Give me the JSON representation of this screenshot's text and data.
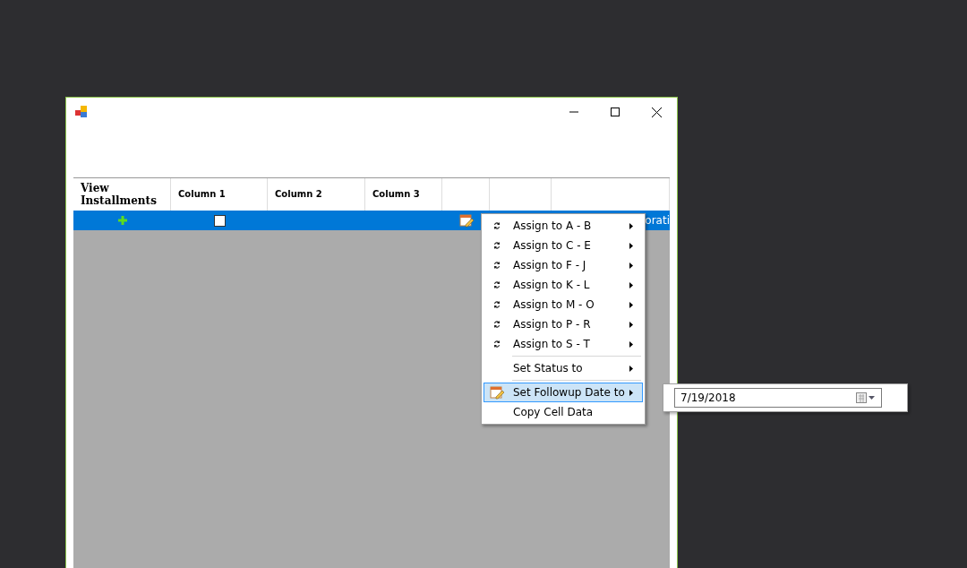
{
  "grid": {
    "columns": [
      {
        "label": "View Installments",
        "kind": "bold"
      },
      {
        "label": "Column 1",
        "kind": "plain"
      },
      {
        "label": "Column 2",
        "kind": "plain"
      },
      {
        "label": "Column 3",
        "kind": "plain"
      },
      {
        "kind": "blank"
      },
      {
        "kind": "blank"
      },
      {
        "kind": "blank"
      }
    ],
    "rows": [
      {
        "selected": true,
        "checked": false,
        "text": "orati"
      }
    ]
  },
  "context_menu": {
    "items": [
      {
        "kind": "assign",
        "label": "Assign to A - B",
        "submenu": true,
        "selected": false
      },
      {
        "kind": "assign",
        "label": "Assign to C - E",
        "submenu": true,
        "selected": false
      },
      {
        "kind": "assign",
        "label": "Assign to F - J",
        "submenu": true,
        "selected": false
      },
      {
        "kind": "assign",
        "label": "Assign to K - L",
        "submenu": true,
        "selected": false
      },
      {
        "kind": "assign",
        "label": "Assign to M - O",
        "submenu": true,
        "selected": false
      },
      {
        "kind": "assign",
        "label": "Assign to P - R",
        "submenu": true,
        "selected": false
      },
      {
        "kind": "assign",
        "label": "Assign to S - T",
        "submenu": true,
        "selected": false
      },
      {
        "kind": "separator"
      },
      {
        "kind": "plain",
        "label": "Set Status to",
        "submenu": true,
        "selected": false
      },
      {
        "kind": "separator"
      },
      {
        "kind": "followup",
        "label": "Set Followup Date to",
        "submenu": true,
        "selected": true
      },
      {
        "kind": "plain",
        "label": "Copy Cell Data",
        "submenu": false,
        "selected": false
      }
    ]
  },
  "submenu": {
    "date_value": "7/19/2018"
  }
}
